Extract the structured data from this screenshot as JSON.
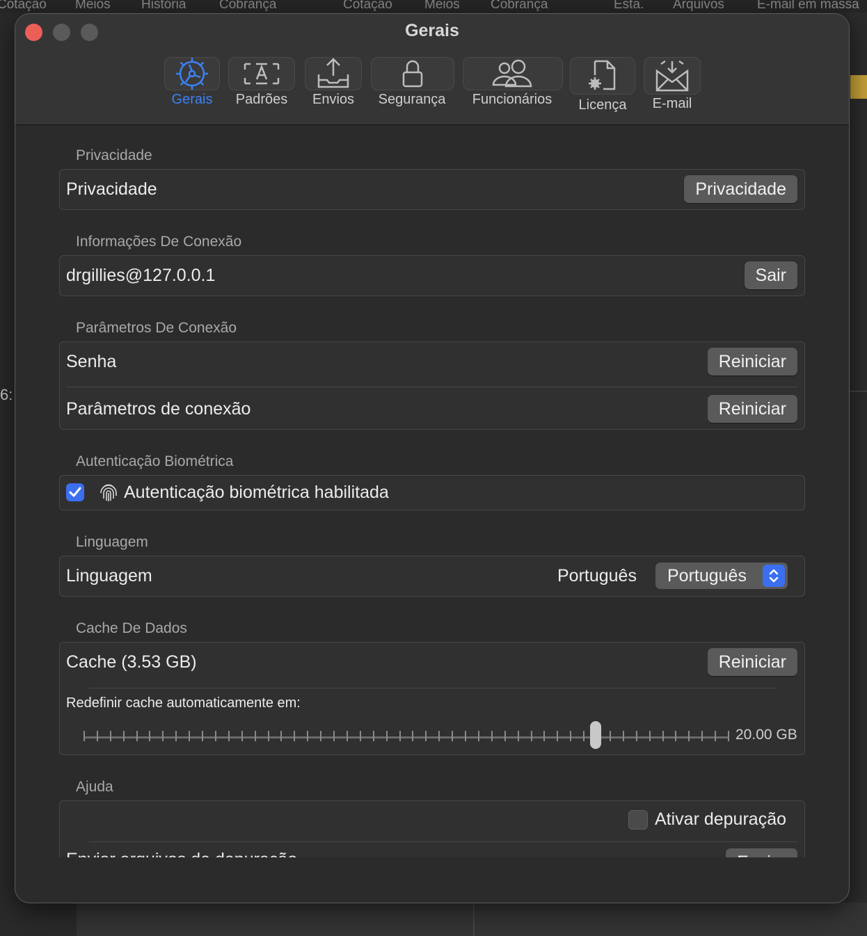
{
  "background": {
    "tabs": [
      "Cotação",
      "Meios",
      "História",
      "Cobrança",
      "Cotação",
      "Meios",
      "Cobrança",
      "Esta.",
      "Arquivos",
      "E-mail em massa"
    ],
    "side_text": "6:"
  },
  "window": {
    "title": "Gerais"
  },
  "toolbar": {
    "items": [
      {
        "label": "Gerais",
        "icon": "gear-icon"
      },
      {
        "label": "Padrões",
        "icon": "text-template-icon"
      },
      {
        "label": "Envios",
        "icon": "tray-upload-icon"
      },
      {
        "label": "Segurança",
        "icon": "lock-icon"
      },
      {
        "label": "Funcionários",
        "icon": "people-icon"
      },
      {
        "label": "Licença",
        "icon": "document-gear-icon"
      },
      {
        "label": "E-mail",
        "icon": "envelope-icon"
      }
    ]
  },
  "sections": {
    "privacy": {
      "heading": "Privacidade",
      "row_label": "Privacidade",
      "button": "Privacidade"
    },
    "connection_info": {
      "heading": "Informações De Conexão",
      "row_label": "drgillies@127.0.0.1",
      "button": "Sair"
    },
    "connection_params": {
      "heading": "Parâmetros De Conexão",
      "rows": [
        {
          "label": "Senha",
          "button": "Reiniciar"
        },
        {
          "label": "Parâmetros de conexão",
          "button": "Reiniciar"
        }
      ]
    },
    "biometric": {
      "heading": "Autenticação Biométrica",
      "checkbox_label": "Autenticação biométrica habilitada",
      "checked": true,
      "icon": "fingerprint-icon"
    },
    "language": {
      "heading": "Linguagem",
      "row_label": "Linguagem",
      "current_value": "Português",
      "select_value": "Português"
    },
    "cache": {
      "heading": "Cache De Dados",
      "row_label": "Cache (3.53 GB)",
      "button": "Reiniciar",
      "auto_reset_label": "Redefinir cache automaticamente em:",
      "slider_value_label": "20.00 GB",
      "slider_fraction": 0.795
    },
    "help": {
      "heading": "Ajuda",
      "debug_label": "Ativar depuração",
      "debug_checked": false,
      "partial_row_label": "Enviar arquivos de depuração",
      "partial_button": "Enviar"
    }
  },
  "colors": {
    "accent": "#3b6ff0",
    "close": "#ec5f57"
  }
}
